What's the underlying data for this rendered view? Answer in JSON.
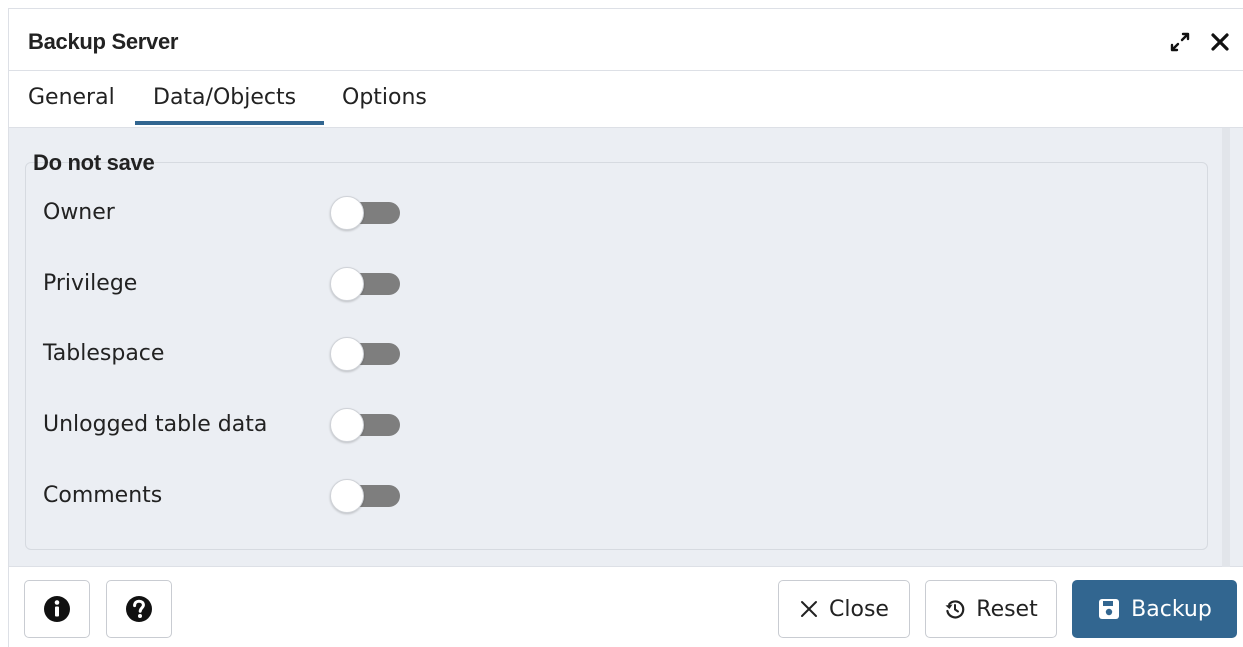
{
  "dialog": {
    "title": "Backup Server",
    "header_icons": [
      "expand-icon",
      "close-icon"
    ]
  },
  "tabs": [
    {
      "label": "General",
      "active": false
    },
    {
      "label": "Data/Objects",
      "active": true
    },
    {
      "label": "Options",
      "active": false
    }
  ],
  "section": {
    "legend": "Do not save",
    "options": [
      {
        "label": "Owner",
        "enabled": false
      },
      {
        "label": "Privilege",
        "enabled": false
      },
      {
        "label": "Tablespace",
        "enabled": false
      },
      {
        "label": "Unlogged table data",
        "enabled": false
      },
      {
        "label": "Comments",
        "enabled": false
      }
    ]
  },
  "footer": {
    "info_icon": "info-circle-icon",
    "help_icon": "question-circle-icon",
    "close_label": "Close",
    "reset_label": "Reset",
    "backup_label": "Backup"
  },
  "colors": {
    "accent": "#326690",
    "content_background": "#ebeef3",
    "toggle_off_track": "#7e7e7e"
  }
}
